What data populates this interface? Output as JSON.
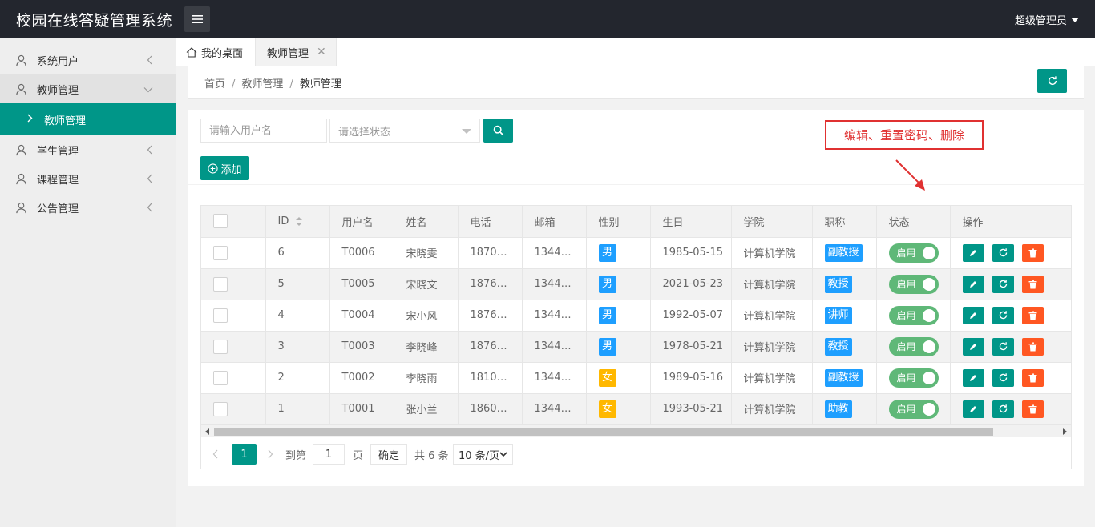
{
  "header": {
    "brand": "校园在线答疑管理系统",
    "user": "超级管理员"
  },
  "sidebar": {
    "items": [
      {
        "label": "系统用户"
      },
      {
        "label": "教师管理"
      },
      {
        "label": "学生管理"
      },
      {
        "label": "课程管理"
      },
      {
        "label": "公告管理"
      }
    ],
    "sub_active": "教师管理"
  },
  "tabs": {
    "home": "我的桌面",
    "active": "教师管理"
  },
  "breadcrumb": {
    "home": "首页",
    "level1": "教师管理",
    "level2": "教师管理"
  },
  "filters": {
    "username_placeholder": "请输入用户名",
    "status_placeholder": "请选择状态",
    "add_label": "添加"
  },
  "annotation": "编辑、重置密码、删除",
  "table": {
    "headers": [
      "",
      "ID",
      "用户名",
      "姓名",
      "电话",
      "邮箱",
      "性别",
      "生日",
      "学院",
      "职称",
      "状态",
      "操作"
    ],
    "rows": [
      {
        "id": "6",
        "username": "T0006",
        "name": "宋晓雯",
        "phone": "1870…",
        "email": "1344…",
        "gender": "男",
        "birthday": "1985-05-15",
        "college": "计算机学院",
        "title": "副教授",
        "status": "启用"
      },
      {
        "id": "5",
        "username": "T0005",
        "name": "宋晓文",
        "phone": "1876…",
        "email": "1344…",
        "gender": "男",
        "birthday": "2021-05-23",
        "college": "计算机学院",
        "title": "教授",
        "status": "启用"
      },
      {
        "id": "4",
        "username": "T0004",
        "name": "宋小风",
        "phone": "1876…",
        "email": "1344…",
        "gender": "男",
        "birthday": "1992-05-07",
        "college": "计算机学院",
        "title": "讲师",
        "status": "启用"
      },
      {
        "id": "3",
        "username": "T0003",
        "name": "李晓峰",
        "phone": "1876…",
        "email": "1344…",
        "gender": "男",
        "birthday": "1978-05-21",
        "college": "计算机学院",
        "title": "教授",
        "status": "启用"
      },
      {
        "id": "2",
        "username": "T0002",
        "name": "李晓雨",
        "phone": "1810…",
        "email": "1344…",
        "gender": "女",
        "birthday": "1989-05-16",
        "college": "计算机学院",
        "title": "副教授",
        "status": "启用"
      },
      {
        "id": "1",
        "username": "T0001",
        "name": "张小兰",
        "phone": "1860…",
        "email": "1344…",
        "gender": "女",
        "birthday": "1993-05-21",
        "college": "计算机学院",
        "title": "助教",
        "status": "启用"
      }
    ]
  },
  "pagination": {
    "current": "1",
    "goto_label": "到第",
    "page_input": "1",
    "page_label": "页",
    "confirm": "确定",
    "total": "共 6 条",
    "page_size": "10 条/页"
  },
  "colors": {
    "primary": "#009688",
    "danger": "#ff5722",
    "info": "#1e9fff",
    "warn": "#ffb800",
    "switch_on": "#5fb878",
    "annotation": "#e03131"
  }
}
